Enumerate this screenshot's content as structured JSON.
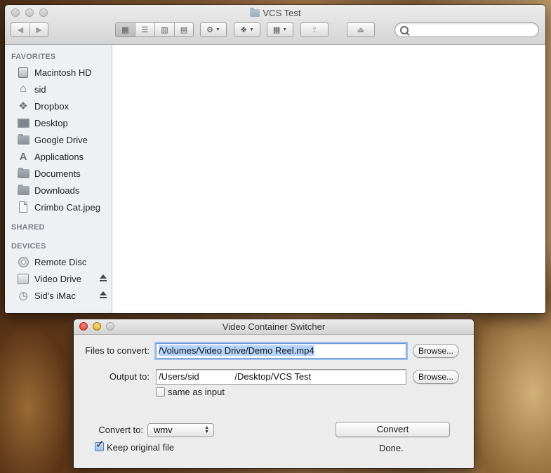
{
  "finder": {
    "title": "VCS Test",
    "sidebar": {
      "favorites_header": "FAVORITES",
      "favorites": [
        {
          "label": "Macintosh HD",
          "icon": "hard-drive-icon"
        },
        {
          "label": "sid",
          "icon": "home-icon"
        },
        {
          "label": "Dropbox",
          "icon": "dropbox-icon"
        },
        {
          "label": "Desktop",
          "icon": "desktop-icon"
        },
        {
          "label": "Google Drive",
          "icon": "folder-icon"
        },
        {
          "label": "Applications",
          "icon": "applications-icon"
        },
        {
          "label": "Documents",
          "icon": "documents-icon"
        },
        {
          "label": "Downloads",
          "icon": "folder-icon"
        },
        {
          "label": "Crimbo Cat.jpeg",
          "icon": "file-icon"
        }
      ],
      "shared_header": "SHARED",
      "devices_header": "DEVICES",
      "devices": [
        {
          "label": "Remote Disc",
          "icon": "disc-icon"
        },
        {
          "label": "Video Drive",
          "icon": "drive-icon"
        },
        {
          "label": "Sid's iMac",
          "icon": "imac-icon"
        }
      ]
    }
  },
  "vcs": {
    "title": "Video Container Switcher",
    "files_label": "Files to convert:",
    "files_value": "/Volumes/Video Drive/Demo Reel.mp4",
    "browse1": "Browse...",
    "output_label": "Output to:",
    "output_value": "/Users/sid              /Desktop/VCS Test",
    "browse2": "Browse...",
    "same_as_input": "same as input",
    "convert_to_label": "Convert to:",
    "convert_to_value": "wmv",
    "keep_original": "Keep original file",
    "convert_button": "Convert",
    "status": "Done."
  }
}
